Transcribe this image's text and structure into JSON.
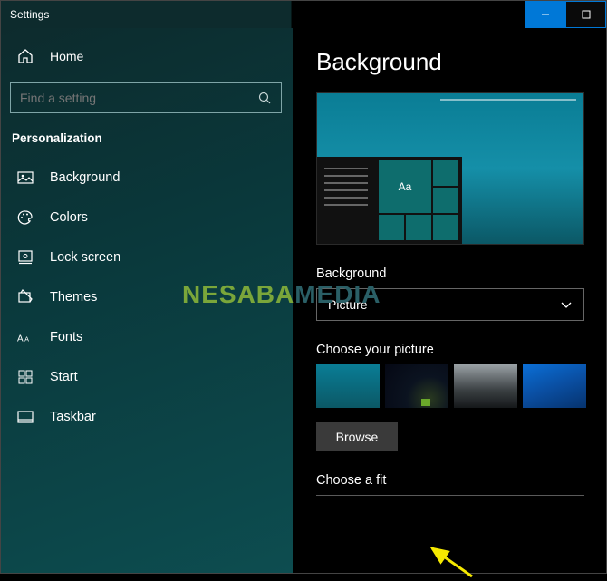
{
  "titlebar": {
    "title": "Settings"
  },
  "sidebar": {
    "home_label": "Home",
    "search_placeholder": "Find a setting",
    "section_label": "Personalization",
    "items": [
      {
        "label": "Background"
      },
      {
        "label": "Colors"
      },
      {
        "label": "Lock screen"
      },
      {
        "label": "Themes"
      },
      {
        "label": "Fonts"
      },
      {
        "label": "Start"
      },
      {
        "label": "Taskbar"
      }
    ]
  },
  "content": {
    "heading": "Background",
    "preview_tile_text": "Aa",
    "bg_label": "Background",
    "bg_select_value": "Picture",
    "choose_picture_label": "Choose your picture",
    "browse_label": "Browse",
    "choose_fit_label": "Choose a fit"
  },
  "watermark": {
    "part1": "NESABA",
    "part2": "MEDIA"
  }
}
